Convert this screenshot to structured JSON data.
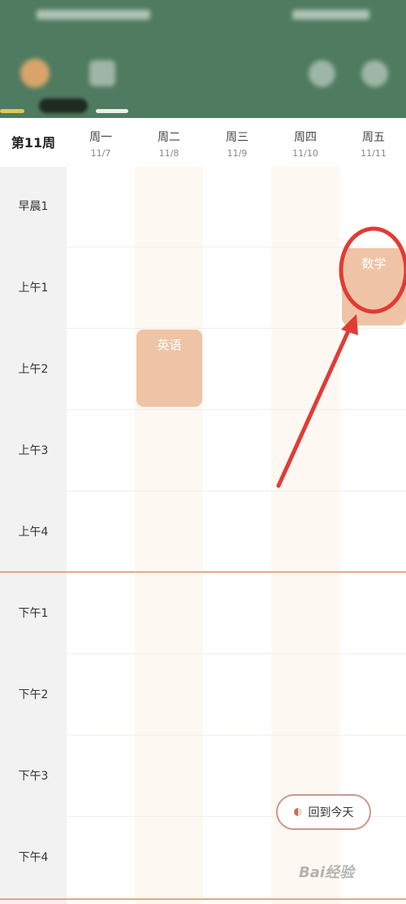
{
  "colors": {
    "header_bg": "#4f7b60",
    "course_bg": "#efc4a6",
    "accent": "#e4a887",
    "annotation": "#e23b35"
  },
  "header": {
    "blurred": true
  },
  "week": {
    "label": "第11周",
    "days": [
      {
        "name": "周一",
        "date": "11/7"
      },
      {
        "name": "周二",
        "date": "11/8"
      },
      {
        "name": "周三",
        "date": "11/9"
      },
      {
        "name": "周四",
        "date": "11/10"
      },
      {
        "name": "周五",
        "date": "11/11"
      }
    ]
  },
  "slots": [
    "早晨1",
    "上午1",
    "上午2",
    "上午3",
    "上午4",
    "下午1",
    "下午2",
    "下午3",
    "下午4"
  ],
  "courses": [
    {
      "name": "英语",
      "day": "周二",
      "slot": "上午2"
    },
    {
      "name": "数学",
      "day": "周五",
      "slot": "上午1"
    }
  ],
  "today_button": {
    "label": "回到今天"
  },
  "watermark": {
    "text": "Bai经验"
  }
}
